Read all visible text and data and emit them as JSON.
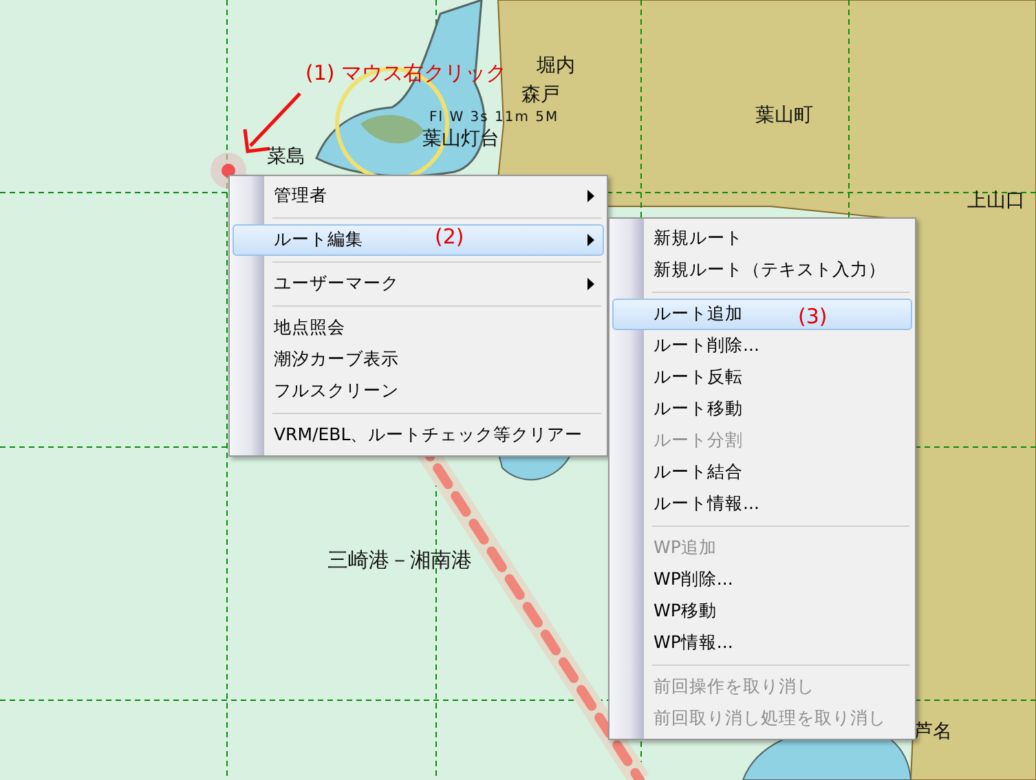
{
  "map": {
    "labels": [
      {
        "kind": "annotation",
        "text": "(1) マウス右クリック"
      },
      {
        "kind": "place",
        "text": "堀内"
      },
      {
        "kind": "place",
        "text": "森戸"
      },
      {
        "kind": "place",
        "text": "葉山町"
      },
      {
        "kind": "light",
        "text": "Fl W 3s 11m 5M"
      },
      {
        "kind": "place",
        "text": "葉山灯台"
      },
      {
        "kind": "place",
        "text": "菜島"
      },
      {
        "kind": "place",
        "text": "上山口"
      },
      {
        "kind": "route",
        "text": "三崎港－湘南港"
      },
      {
        "kind": "place",
        "text": "芦名"
      },
      {
        "kind": "annotation",
        "text": "(2)"
      },
      {
        "kind": "annotation",
        "text": "(3)"
      }
    ]
  },
  "context_menu": {
    "items": [
      {
        "kind": "item",
        "label": "管理者",
        "selected": false,
        "disabled": false,
        "submenu": true
      },
      {
        "kind": "separator"
      },
      {
        "kind": "item",
        "label": "ルート編集",
        "selected": true,
        "disabled": false,
        "submenu": true
      },
      {
        "kind": "separator"
      },
      {
        "kind": "item",
        "label": "ユーザーマーク",
        "selected": false,
        "disabled": false,
        "submenu": true
      },
      {
        "kind": "separator"
      },
      {
        "kind": "item",
        "label": "地点照会",
        "selected": false,
        "disabled": false,
        "submenu": false
      },
      {
        "kind": "item",
        "label": "潮汐カーブ表示",
        "selected": false,
        "disabled": false,
        "submenu": false
      },
      {
        "kind": "item",
        "label": "フルスクリーン",
        "selected": false,
        "disabled": false,
        "submenu": false
      },
      {
        "kind": "separator"
      },
      {
        "kind": "item",
        "label": "VRM/EBL、ルートチェック等クリアー",
        "selected": false,
        "disabled": false,
        "submenu": false
      }
    ]
  },
  "submenu": {
    "items": [
      {
        "kind": "item",
        "label": "新規ルート",
        "selected": false,
        "disabled": false
      },
      {
        "kind": "item",
        "label": "新規ルート（テキスト入力）",
        "selected": false,
        "disabled": false
      },
      {
        "kind": "separator"
      },
      {
        "kind": "item",
        "label": "ルート追加",
        "selected": true,
        "disabled": false
      },
      {
        "kind": "item",
        "label": "ルート削除...",
        "selected": false,
        "disabled": false
      },
      {
        "kind": "item",
        "label": "ルート反転",
        "selected": false,
        "disabled": false
      },
      {
        "kind": "item",
        "label": "ルート移動",
        "selected": false,
        "disabled": false
      },
      {
        "kind": "item",
        "label": "ルート分割",
        "selected": false,
        "disabled": true
      },
      {
        "kind": "item",
        "label": "ルート結合",
        "selected": false,
        "disabled": false
      },
      {
        "kind": "item",
        "label": "ルート情報...",
        "selected": false,
        "disabled": false
      },
      {
        "kind": "separator"
      },
      {
        "kind": "item",
        "label": "WP追加",
        "selected": false,
        "disabled": true
      },
      {
        "kind": "item",
        "label": "WP削除...",
        "selected": false,
        "disabled": false
      },
      {
        "kind": "item",
        "label": "WP移動",
        "selected": false,
        "disabled": false
      },
      {
        "kind": "item",
        "label": "WP情報...",
        "selected": false,
        "disabled": false
      },
      {
        "kind": "separator"
      },
      {
        "kind": "item",
        "label": "前回操作を取り消し",
        "selected": false,
        "disabled": true
      },
      {
        "kind": "item",
        "label": "前回取り消し処理を取り消し",
        "selected": false,
        "disabled": true
      }
    ]
  }
}
